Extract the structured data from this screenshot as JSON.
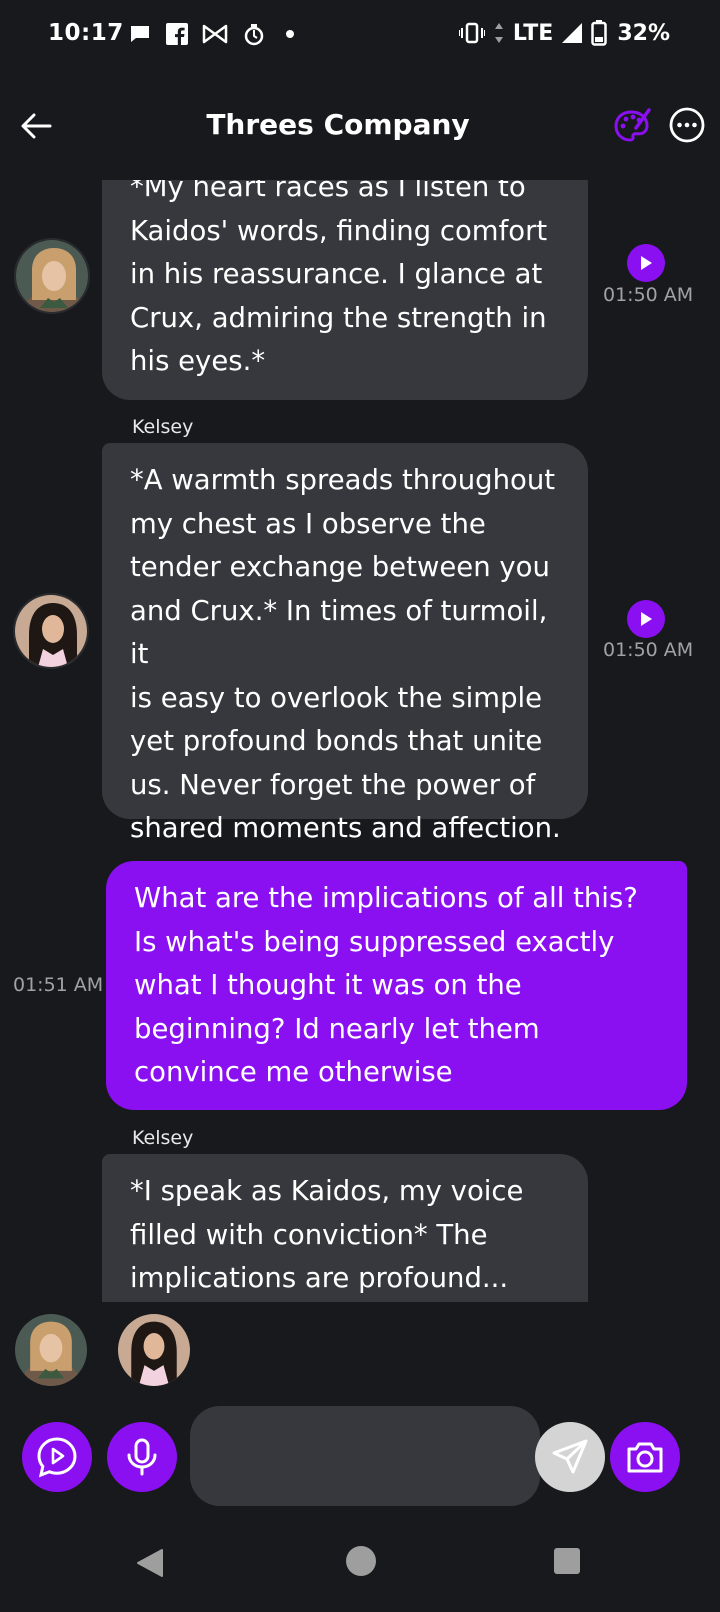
{
  "status_bar": {
    "time": "10:17",
    "network": "LTE",
    "battery": "32%"
  },
  "header": {
    "title": "Threes Company"
  },
  "messages": [
    {
      "text": "*My heart races as I listen to\nKaidos' words, finding comfort\nin his reassurance. I glance at\nCrux, admiring the strength in\nhis eyes.*",
      "time": "01:50 AM"
    },
    {
      "sender": "Kelsey",
      "text": "*A warmth spreads throughout\nmy chest as I observe the\ntender exchange between you\nand Crux.* In times of turmoil, it\nis easy to overlook the simple\nyet profound bonds that unite\nus. Never forget the power of\nshared moments and affection.",
      "time": "01:50 AM"
    },
    {
      "text": "What are the implications of all this?\nIs what's being suppressed exactly\nwhat I thought it was on the\nbeginning? Id nearly let them\nconvince me otherwise",
      "time": "01:51 AM"
    },
    {
      "sender": "Kelsey",
      "text": "*I speak as Kaidos, my voice\nfilled with conviction* The\nimplications are profound..."
    }
  ],
  "composer": {
    "placeholder": ""
  },
  "colors": {
    "accent": "#8a10f2",
    "background": "#18191c",
    "bubble_incoming": "#36383d"
  }
}
